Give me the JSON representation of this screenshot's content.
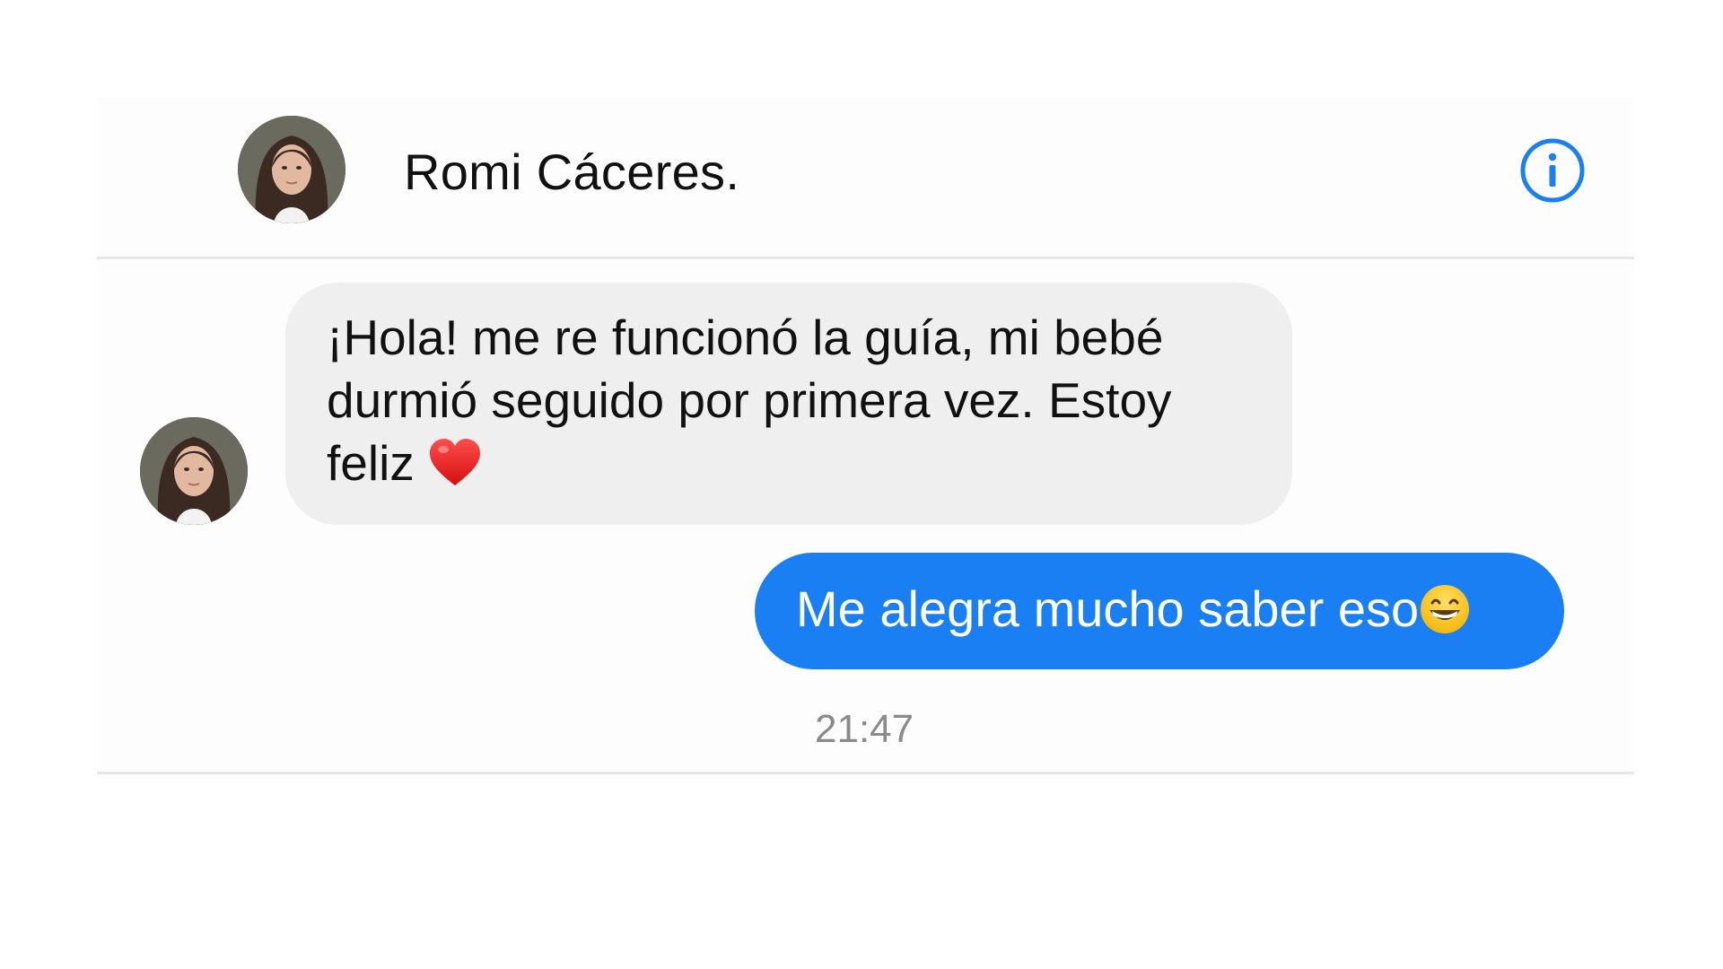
{
  "header": {
    "contact_name": "Romi Cáceres.",
    "info_icon": "info-circle-icon"
  },
  "messages": [
    {
      "direction": "incoming",
      "text": "¡Hola! me re funcionó la guía, mi bebé durmió seguido por primera vez. Estoy feliz",
      "emoji": "red-heart-icon"
    },
    {
      "direction": "outgoing",
      "text": "Me alegra mucho saber eso",
      "emoji": "grinning-face-icon"
    }
  ],
  "timestamp": "21:47",
  "colors": {
    "accent": "#1a7ff2",
    "incoming_bubble": "#efefef",
    "outgoing_text": "#ffffff",
    "timestamp": "#8a8a8a"
  }
}
